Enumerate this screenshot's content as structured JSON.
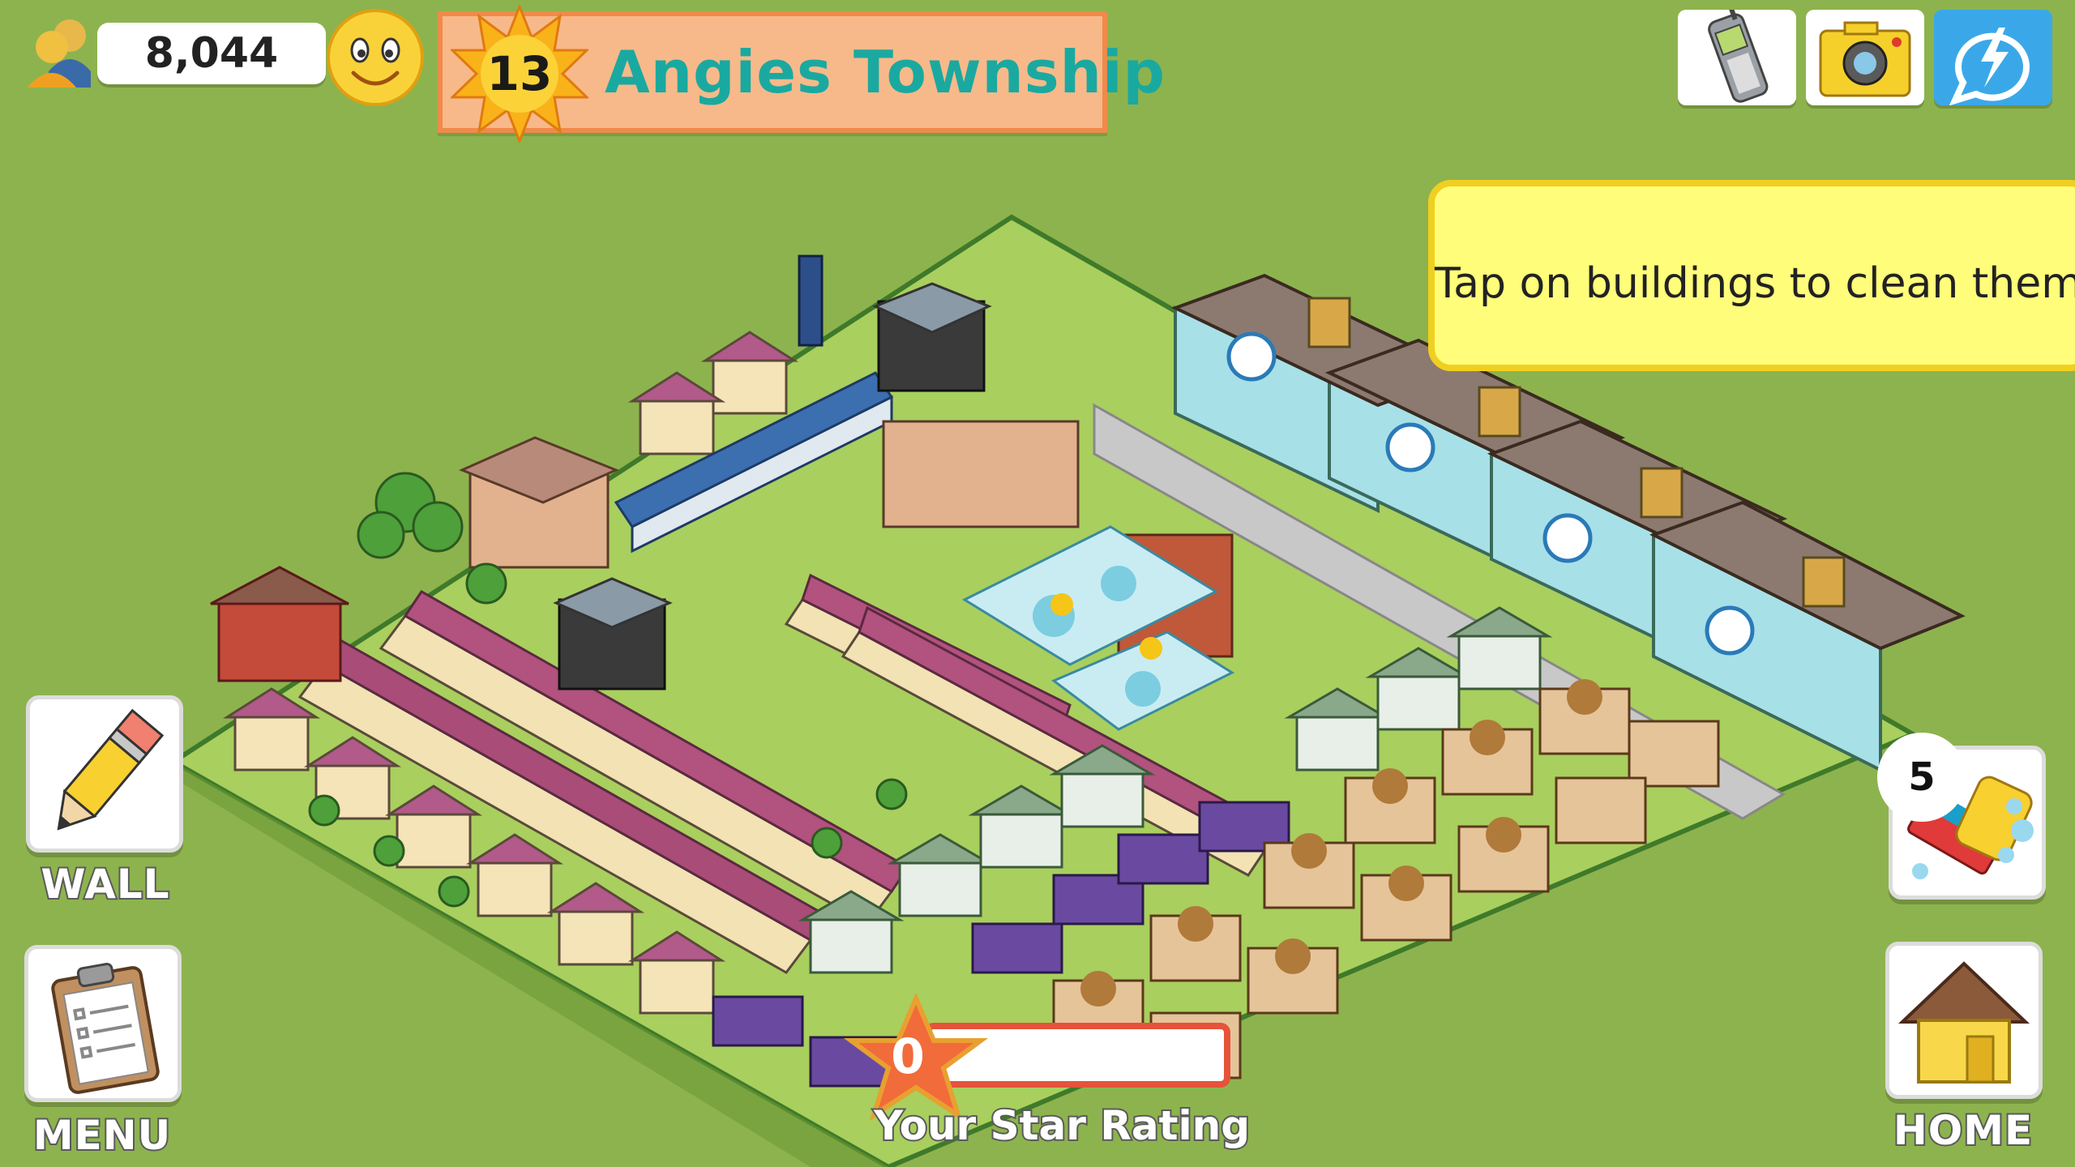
{
  "hud": {
    "population": "8,044",
    "mood_icon": "smiley-face-icon",
    "level": "13",
    "town_name": "Angies Township"
  },
  "top_buttons": [
    {
      "name": "phone-button",
      "icon": "cell-phone-icon"
    },
    {
      "name": "camera-button",
      "icon": "camera-icon"
    },
    {
      "name": "social-button",
      "icon": "lightning-chat-icon"
    }
  ],
  "tip": {
    "text": "Tap on buildings to clean them."
  },
  "side_buttons": {
    "wall": "WALL",
    "menu": "MENU",
    "home": "HOME"
  },
  "clean_tool": {
    "count": "5",
    "icon": "sponge-broom-icon"
  },
  "star_rating": {
    "value": "0",
    "label": "Your Star Rating",
    "progress": 0
  },
  "colors": {
    "grass": "#8db34e",
    "lot": "#a9cf5e",
    "banner": "#f7b98a",
    "banner_border": "#f08a4a",
    "town_name": "#1aa9a0",
    "tip_fill": "#fffd7a",
    "tip_border": "#f0cf20",
    "star": "#f26b3a"
  }
}
